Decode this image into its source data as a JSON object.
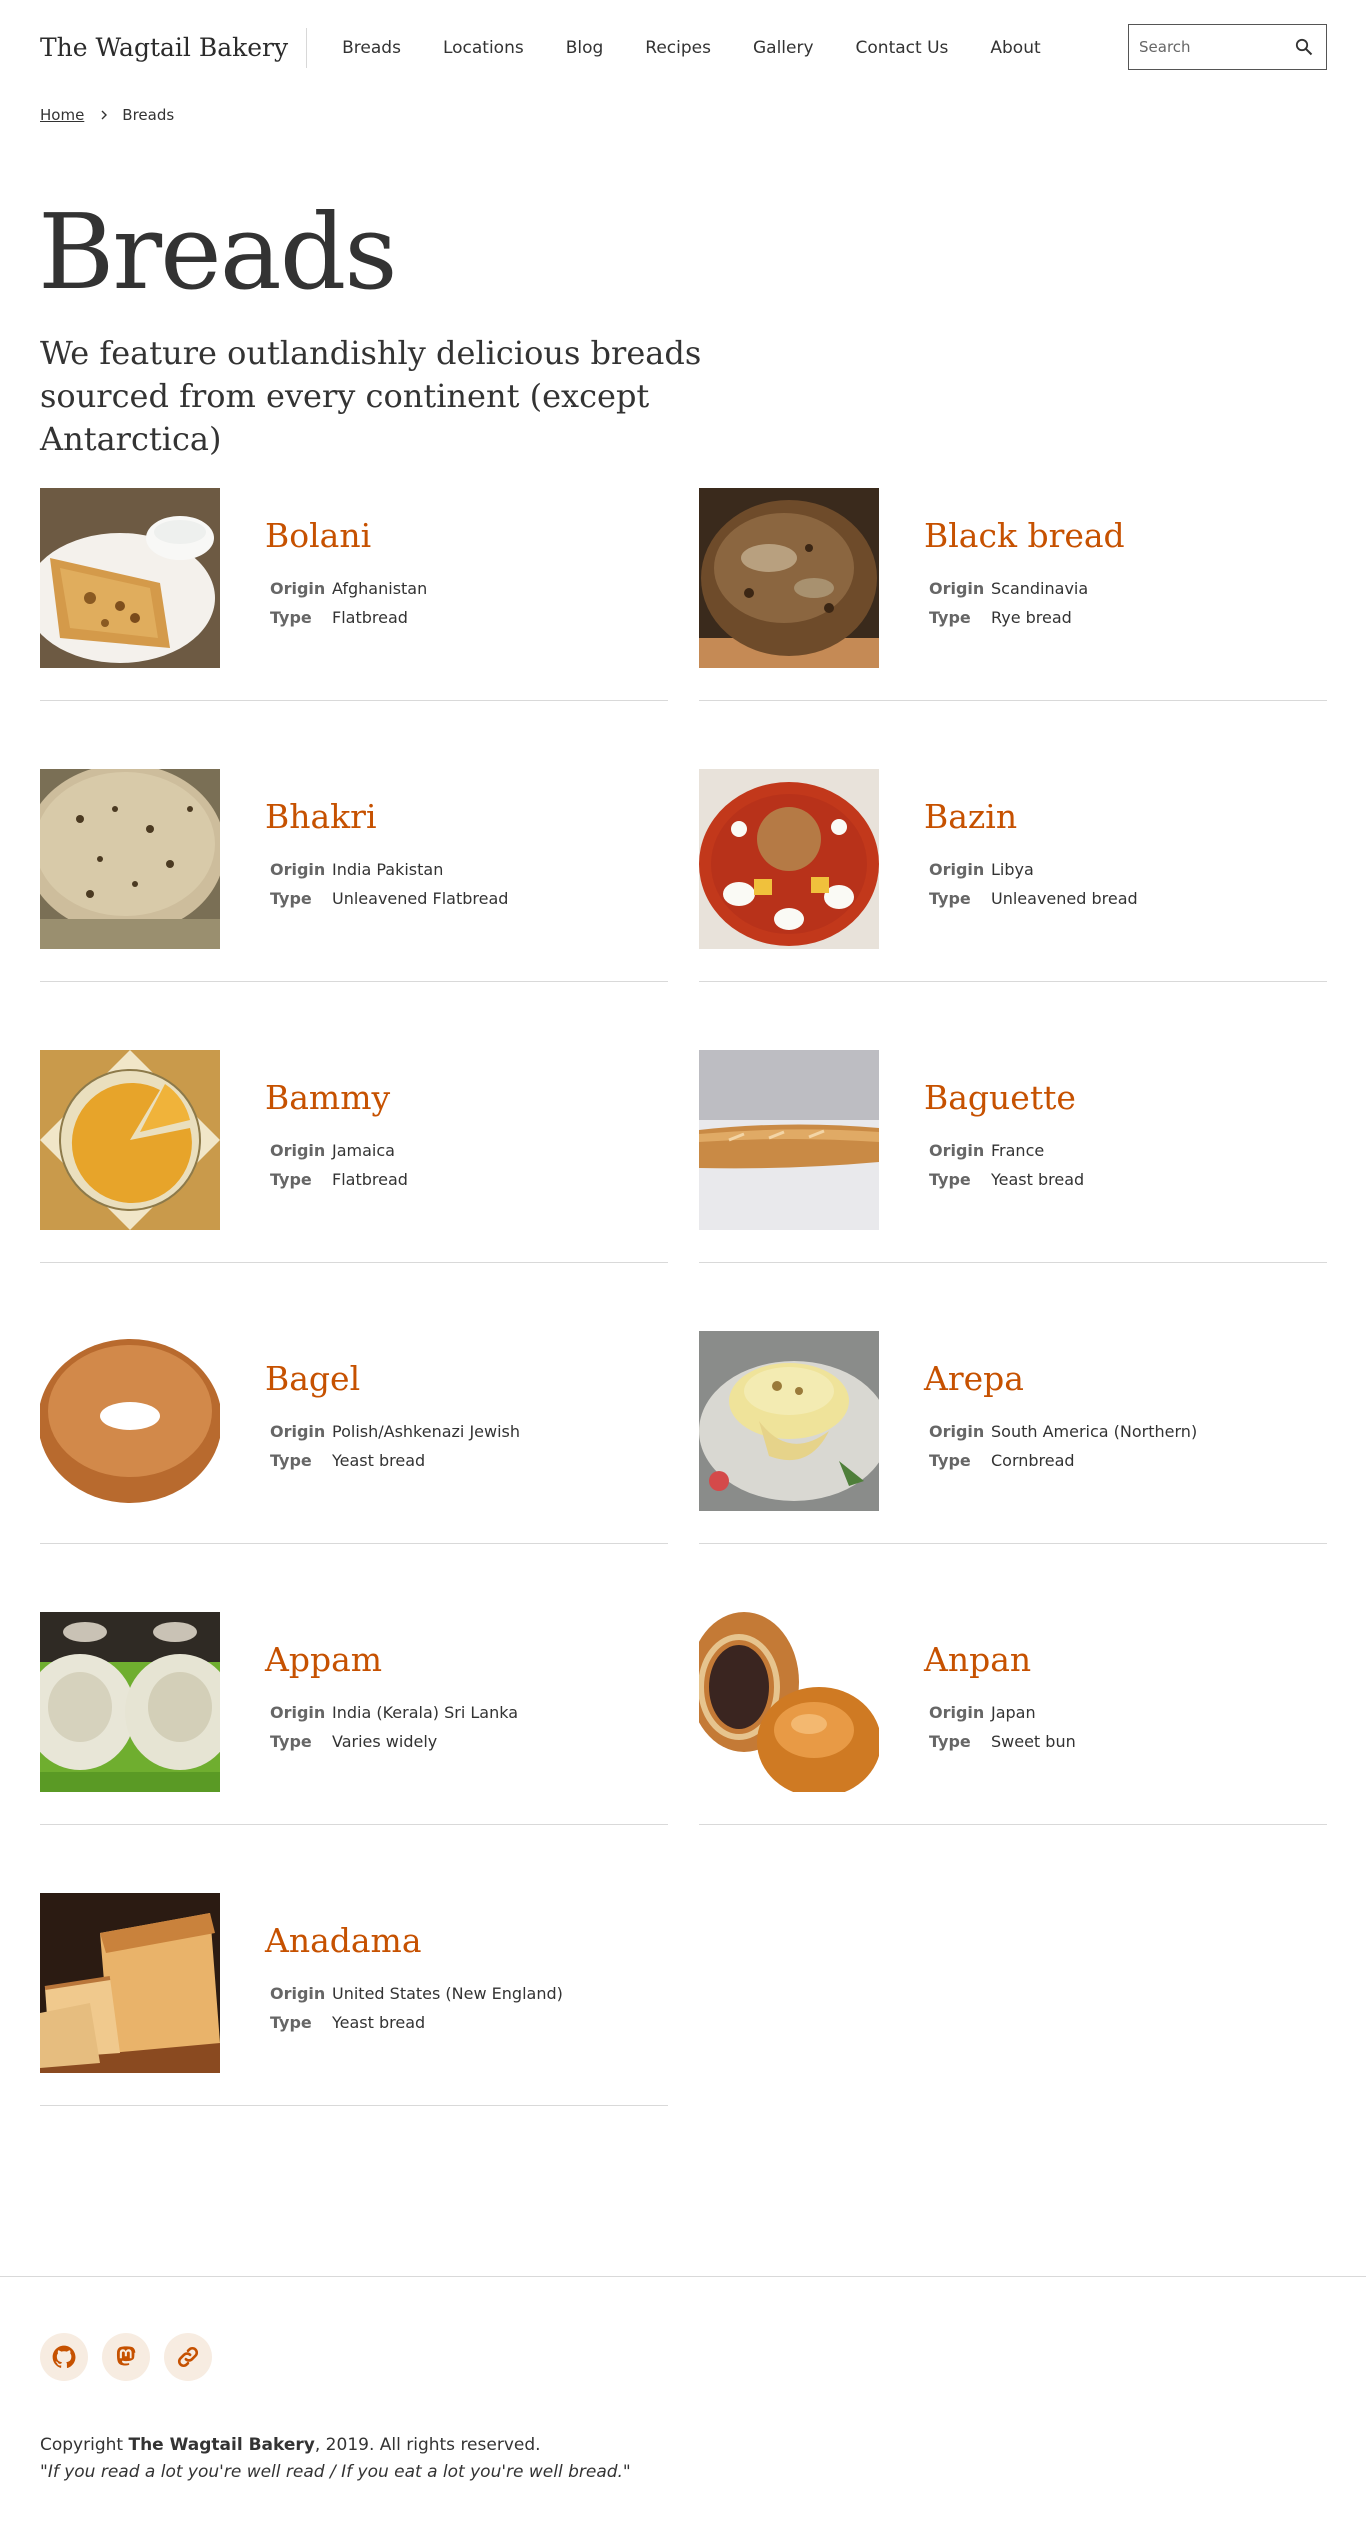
{
  "header": {
    "logo": "The Wagtail Bakery",
    "nav": [
      "Breads",
      "Locations",
      "Blog",
      "Recipes",
      "Gallery",
      "Contact Us",
      "About"
    ],
    "search_placeholder": "Search"
  },
  "breadcrumb": {
    "home": "Home",
    "current": "Breads"
  },
  "page": {
    "title": "Breads",
    "intro": "We feature outlandishly delicious breads sourced from every continent (except Antarctica)"
  },
  "labels": {
    "origin": "Origin",
    "type": "Type"
  },
  "breads": [
    {
      "name": "Bolani",
      "origin": "Afghanistan",
      "type": "Flatbread",
      "icon": "flatbread-plate-photo"
    },
    {
      "name": "Black bread",
      "origin": "Scandinavia",
      "type": "Rye bread",
      "icon": "rye-loaf-photo"
    },
    {
      "name": "Bhakri",
      "origin": "India Pakistan",
      "type": "Unleavened Flatbread",
      "icon": "bhakri-photo"
    },
    {
      "name": "Bazin",
      "origin": "Libya",
      "type": "Unleavened bread",
      "icon": "bazin-stew-photo"
    },
    {
      "name": "Bammy",
      "origin": "Jamaica",
      "type": "Flatbread",
      "icon": "bammy-plate-photo"
    },
    {
      "name": "Baguette",
      "origin": "France",
      "type": "Yeast bread",
      "icon": "baguette-photo"
    },
    {
      "name": "Bagel",
      "origin": "Polish/Ashkenazi Jewish",
      "type": "Yeast bread",
      "icon": "bagel-photo"
    },
    {
      "name": "Arepa",
      "origin": "South America (Northern)",
      "type": "Cornbread",
      "icon": "arepa-photo"
    },
    {
      "name": "Appam",
      "origin": "India (Kerala) Sri Lanka",
      "type": "Varies widely",
      "icon": "appam-photo"
    },
    {
      "name": "Anpan",
      "origin": "Japan",
      "type": "Sweet bun",
      "icon": "anpan-photo"
    },
    {
      "name": "Anadama",
      "origin": "United States (New England)",
      "type": "Yeast bread",
      "icon": "anadama-loaf-photo"
    }
  ],
  "footer": {
    "social_icons": [
      "github-icon",
      "mastodon-icon",
      "link-icon"
    ],
    "copyright_prefix": "Copyright ",
    "company": "The Wagtail Bakery",
    "copyright_suffix": ", 2019. All rights reserved.",
    "quote": "\"If you read a lot you're well read / If you eat a lot you're well bread.\""
  },
  "colors": {
    "accent": "#c65100",
    "social_bg": "#f7ece1",
    "divider": "#d9d9d9"
  }
}
